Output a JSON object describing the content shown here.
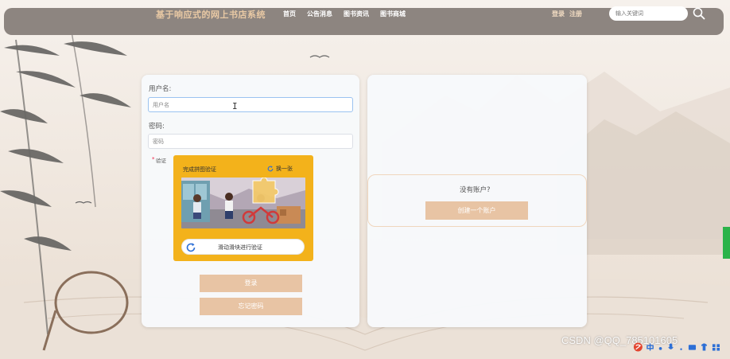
{
  "nav": {
    "title": "基于响应式的网上书店系统",
    "links": [
      "首页",
      "公告消息",
      "图书资讯",
      "图书商城"
    ],
    "login": "登录",
    "register": "注册",
    "search_placeholder": "输入关键词"
  },
  "login_form": {
    "username_label": "用户名:",
    "username_placeholder": "用户名",
    "password_label": "密码:",
    "password_placeholder": "密码",
    "required_mark": "*",
    "verify_label": "验证",
    "login_button": "登录",
    "forgot_button": "忘记密码"
  },
  "captcha": {
    "title": "完成拼图验证",
    "refresh": "换一张",
    "slider_text": "滑动滑块进行验证"
  },
  "register": {
    "prompt": "没有账户?",
    "create_button": "创建一个账户"
  },
  "watermark": "CSDN @QQ_785101605",
  "colors": {
    "navbar": "#8d8580",
    "title": "#e9c9a4",
    "accent_button": "#e8c4a4",
    "captcha_bg": "#f3b21b"
  }
}
